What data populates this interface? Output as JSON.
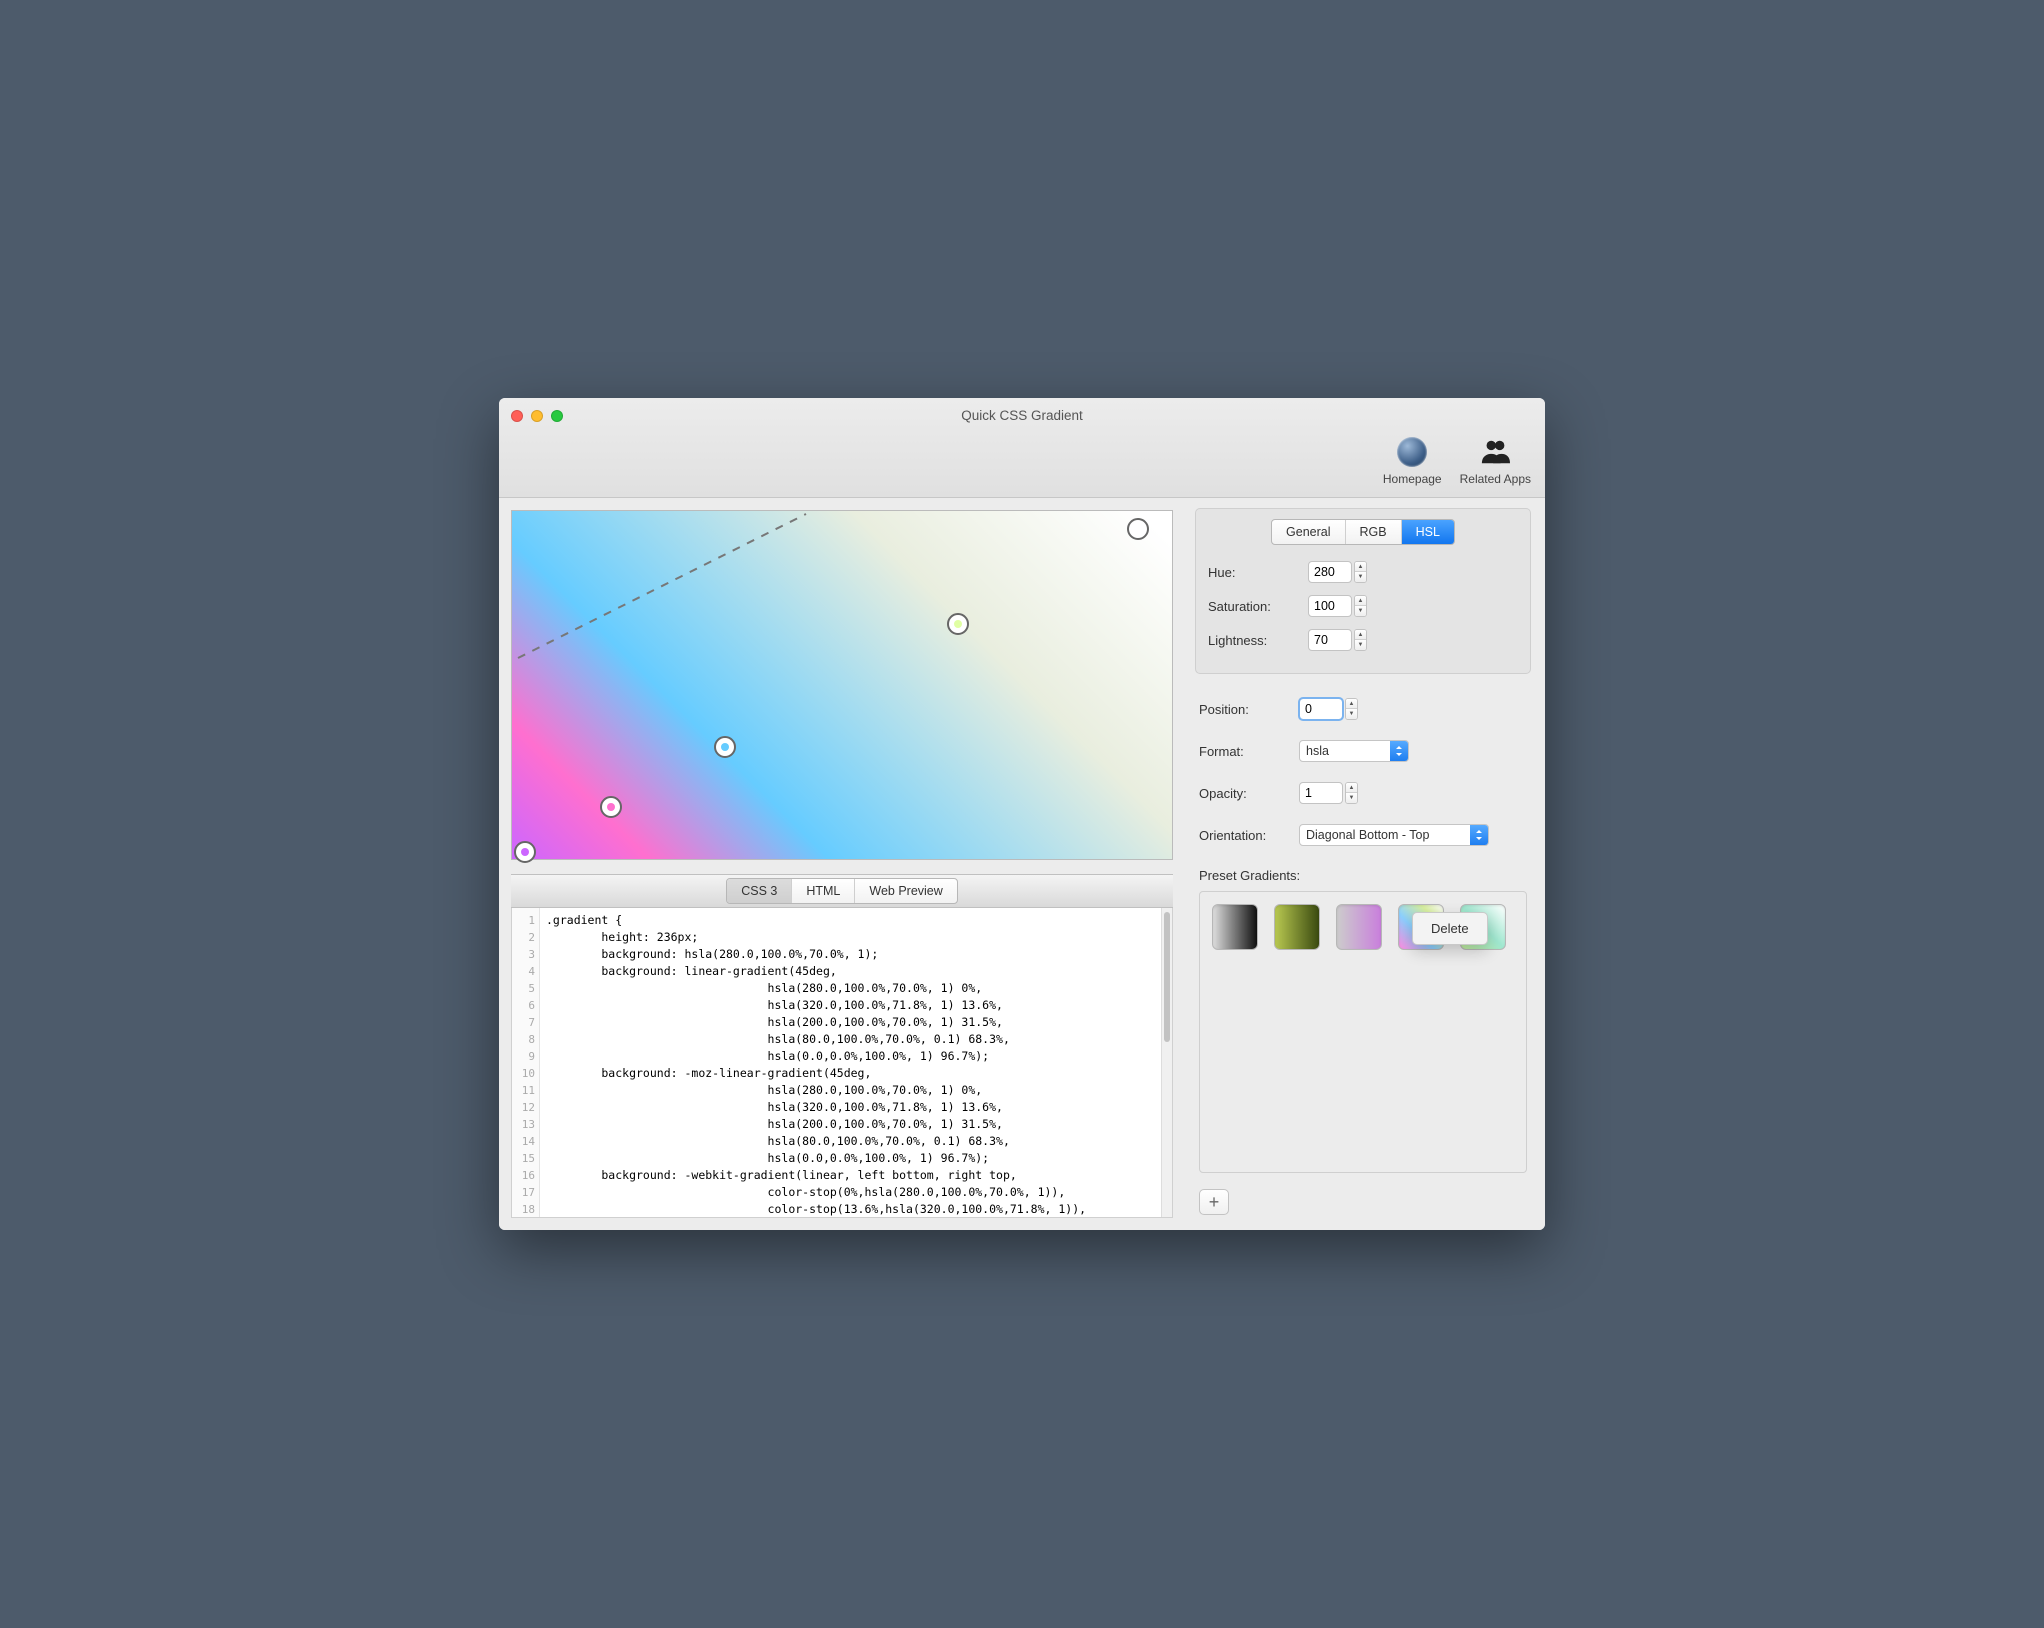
{
  "window": {
    "title": "Quick CSS Gradient"
  },
  "toolbar": {
    "homepage_label": "Homepage",
    "related_label": "Related Apps"
  },
  "color_tabs": {
    "general": "General",
    "rgb": "RGB",
    "hsl": "HSL",
    "active": "HSL"
  },
  "hsl": {
    "hue_label": "Hue:",
    "hue_value": "280",
    "sat_label": "Saturation:",
    "sat_value": "100",
    "lig_label": "Lightness:",
    "lig_value": "70"
  },
  "stop": {
    "position_label": "Position:",
    "position_value": "0",
    "format_label": "Format:",
    "format_value": "hsla",
    "opacity_label": "Opacity:",
    "opacity_value": "1",
    "orient_label": "Orientation:",
    "orient_value": "Diagonal Bottom - Top"
  },
  "presets_label": "Preset Gradients:",
  "context_delete": "Delete",
  "code_tabs": {
    "css3": "CSS 3",
    "html": "HTML",
    "web": "Web Preview"
  },
  "code_lines": [
    ".gradient {",
    "        height: 236px;",
    "        background: hsla(280.0,100.0%,70.0%, 1);",
    "        background: linear-gradient(45deg,",
    "                                hsla(280.0,100.0%,70.0%, 1) 0%,",
    "                                hsla(320.0,100.0%,71.8%, 1) 13.6%,",
    "                                hsla(200.0,100.0%,70.0%, 1) 31.5%,",
    "                                hsla(80.0,100.0%,70.0%, 0.1) 68.3%,",
    "                                hsla(0.0,0.0%,100.0%, 1) 96.7%);",
    "        background: -moz-linear-gradient(45deg,",
    "                                hsla(280.0,100.0%,70.0%, 1) 0%,",
    "                                hsla(320.0,100.0%,71.8%, 1) 13.6%,",
    "                                hsla(200.0,100.0%,70.0%, 1) 31.5%,",
    "                                hsla(80.0,100.0%,70.0%, 0.1) 68.3%,",
    "                                hsla(0.0,0.0%,100.0%, 1) 96.7%);",
    "        background: -webkit-gradient(linear, left bottom, right top,",
    "                                color-stop(0%,hsla(280.0,100.0%,70.0%, 1)),",
    "                                color-stop(13.6%,hsla(320.0,100.0%,71.8%, 1)),"
  ],
  "gradient_stops": [
    {
      "pos": 0.0,
      "color": "hsl(280,100%,70%)"
    },
    {
      "pos": 0.136,
      "color": "hsl(320,100%,72%)"
    },
    {
      "pos": 0.315,
      "color": "hsl(200,100%,70%)"
    },
    {
      "pos": 0.683,
      "color": "hsla(80,100%,70%,0.6)"
    },
    {
      "pos": 0.967,
      "color": "hsl(0,0%,100%)"
    }
  ],
  "preset_gradients": [
    "linear-gradient(90deg,#ddd,#111)",
    "linear-gradient(90deg,#b8c850,#3a4a10)",
    "linear-gradient(90deg,#ccc,#c97fdc)",
    "linear-gradient(45deg,#ff8ce0,#8cd0ff 40%,#d9f0a0 75%,#fff)",
    "linear-gradient(45deg,#c4f0a0,#a0e8d0 50%,#fff)"
  ]
}
